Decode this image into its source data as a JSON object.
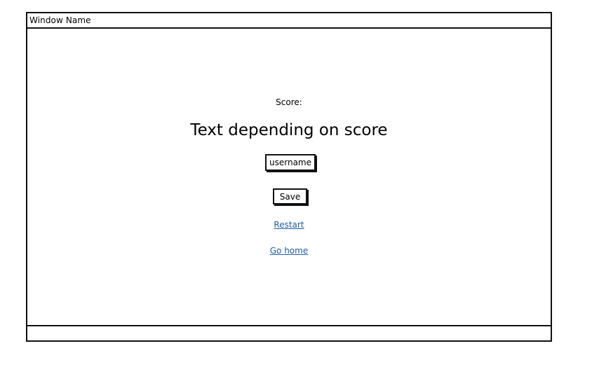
{
  "window": {
    "title": "Window Name"
  },
  "main": {
    "score_label": "Score:",
    "score_text": "Text depending on score",
    "username_value": "username",
    "save_label": "Save",
    "restart_label": "Restart",
    "home_label": "Go home"
  },
  "colors": {
    "link": "#1f5fa8",
    "border": "#111111"
  }
}
